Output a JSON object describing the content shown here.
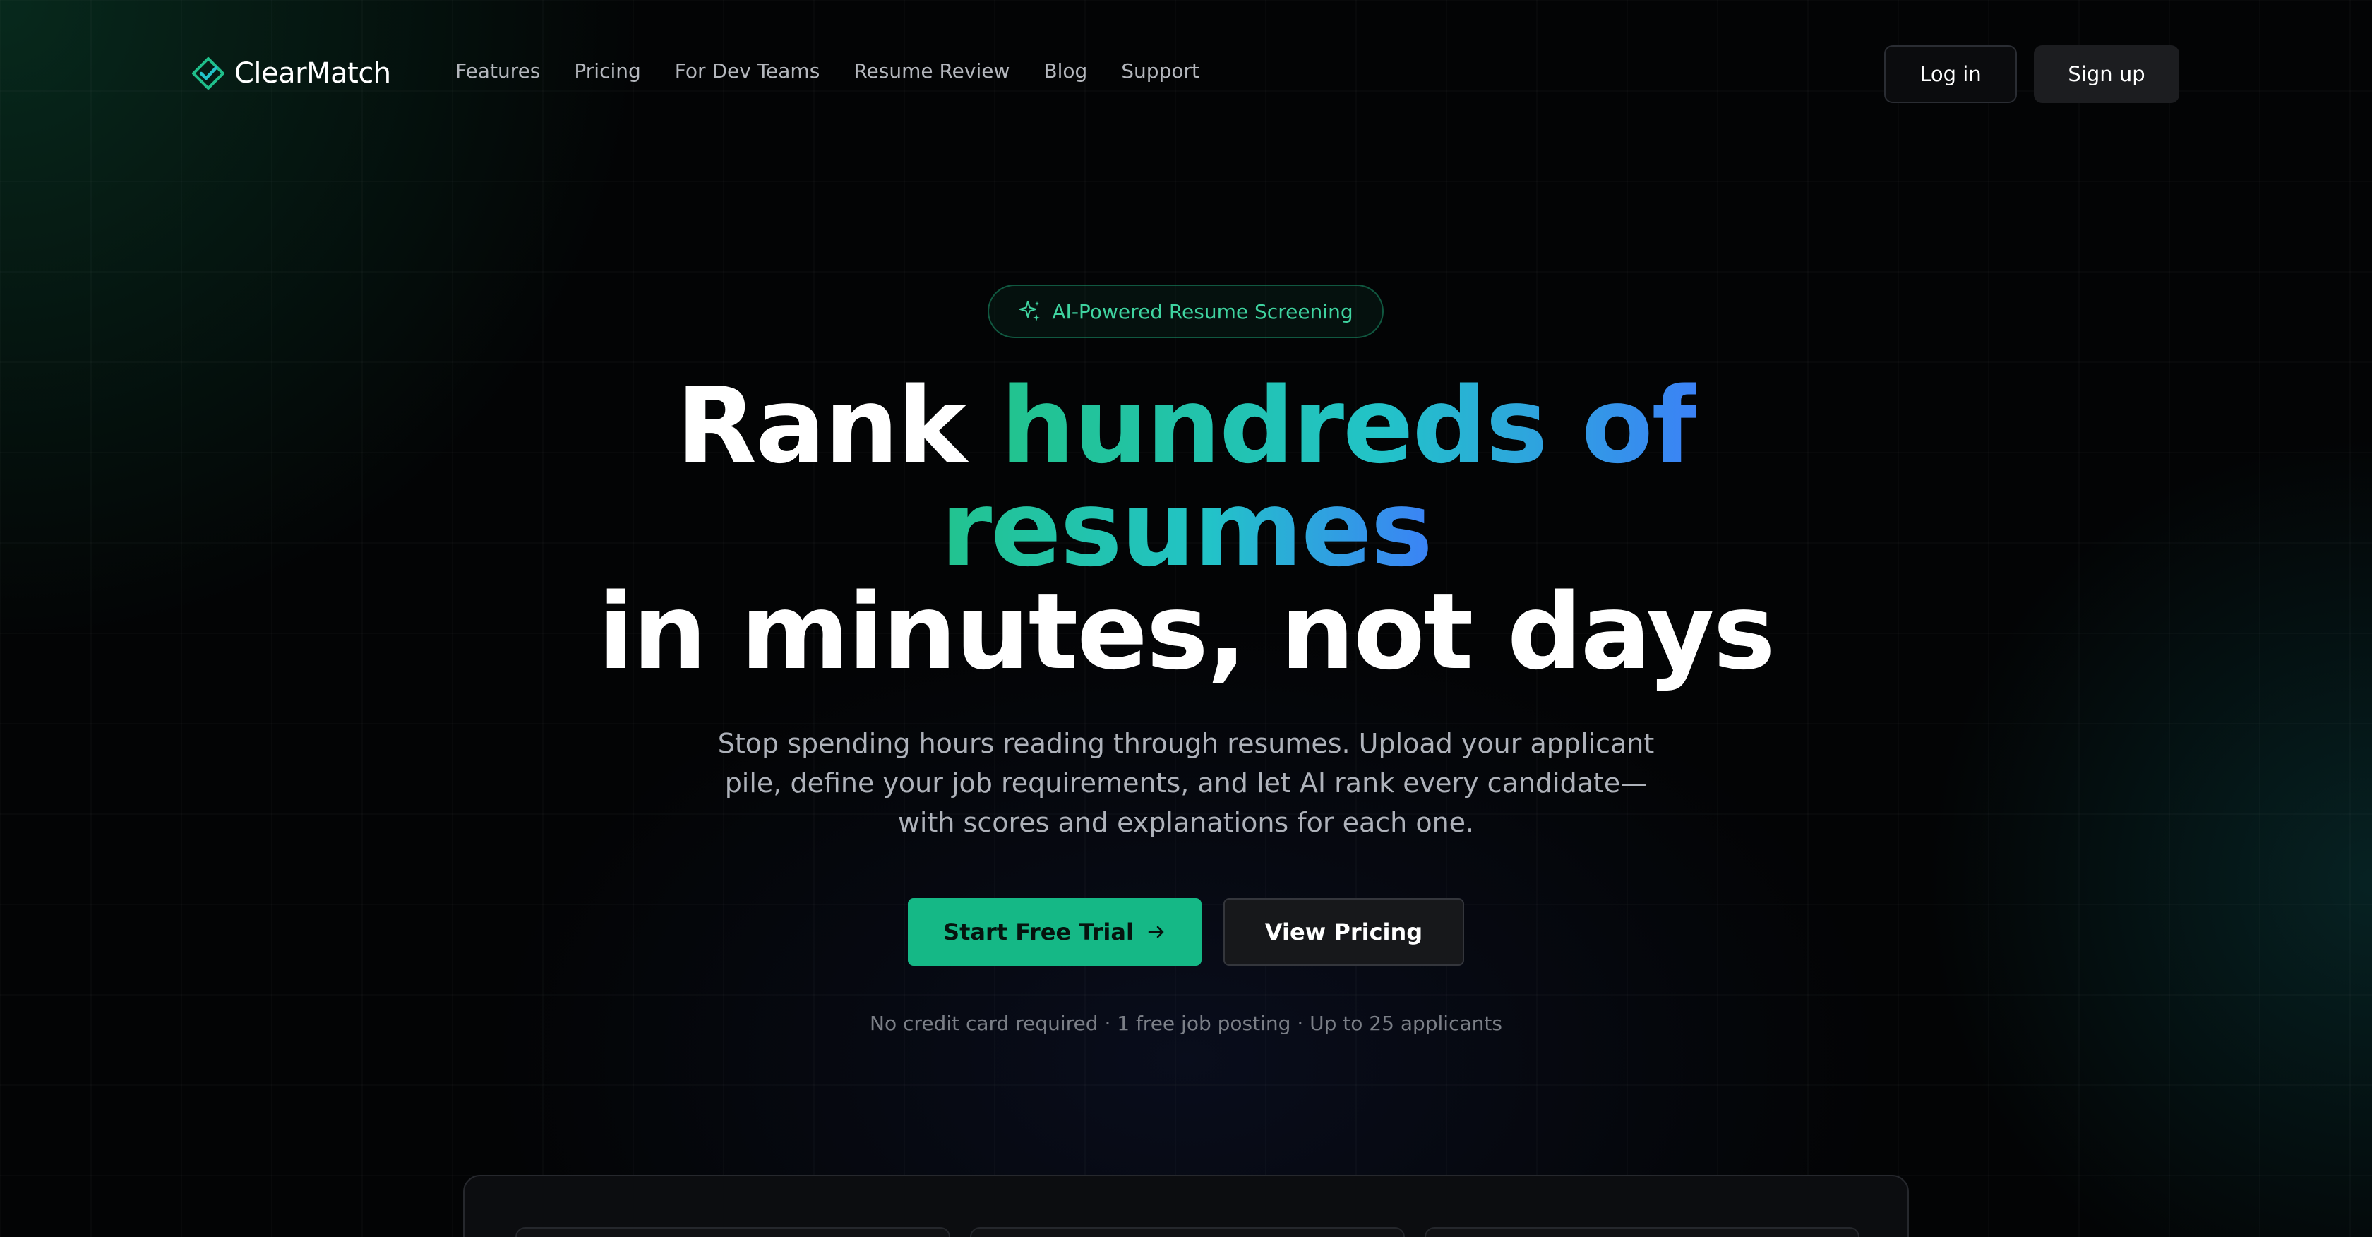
{
  "brand": {
    "name": "ClearMatch",
    "accent": "#15b886"
  },
  "nav": {
    "links": [
      "Features",
      "Pricing",
      "For Dev Teams",
      "Resume Review",
      "Blog",
      "Support"
    ],
    "login_label": "Log in",
    "signup_label": "Sign up"
  },
  "hero": {
    "badge_icon": "sparkle-icon",
    "badge_text": "AI-Powered Resume Screening",
    "headline_part1": "Rank ",
    "headline_highlight_1": "hundreds of",
    "headline_highlight_2": "resumes",
    "headline_part2": "in minutes, not days",
    "subtitle": "Stop spending hours reading through resumes. Upload your applicant pile, define your job requirements, and let AI rank every candidate—with scores and explanations for each one.",
    "primary_cta": "Start Free Trial",
    "primary_cta_icon": "arrow-right-icon",
    "secondary_cta": "View Pricing",
    "fineprint": "No credit card required · 1 free job posting · Up to 25 applicants"
  },
  "colors": {
    "gradient_start": "#22c38e",
    "gradient_mid": "#22c3c8",
    "gradient_end": "#3b82f6",
    "background": "#030405"
  }
}
